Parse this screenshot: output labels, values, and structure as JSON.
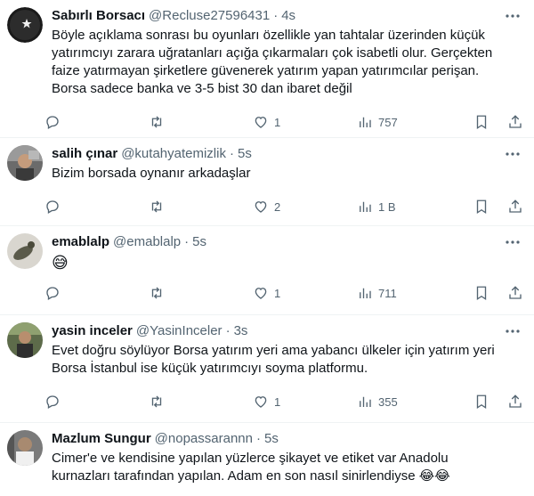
{
  "tweets": [
    {
      "name": "Sabırlı Borsacı",
      "handle": "@Recluse27596431",
      "dot": "·",
      "time": "4s",
      "text": "Böyle açıklama sonrası bu oyunları özellikle yan tahtalar üzerinden küçük\nyatırımcıyı zarara uğratanları açığa çıkarmaları çok isabetli olur. Gerçekten\nfaize yatırmayan şirketlere güvenerek yatırım yapan yatırımcılar perişan.\nBorsa sadece banka ve 3-5 bist 30 dan ibaret değil",
      "replies": "",
      "retweets": "",
      "likes": "1",
      "views": "757"
    },
    {
      "name": "salih çınar",
      "handle": "@kutahyatemizlik",
      "dot": "·",
      "time": "5s",
      "text": "Bizim borsada oynanır arkadaşlar",
      "replies": "",
      "retweets": "",
      "likes": "2",
      "views": "1 B"
    },
    {
      "name": "emablalp",
      "handle": "@emablalp",
      "dot": "·",
      "time": "5s",
      "text": "😅",
      "replies": "",
      "retweets": "",
      "likes": "1",
      "views": "711"
    },
    {
      "name": "yasin inceler",
      "handle": "@YasinInceler",
      "dot": "·",
      "time": "3s",
      "text": "Evet doğru söylüyor Borsa yatırım yeri ama yabancı ülkeler için yatırım yeri\nBorsa İstanbul ise küçük yatırımcıyı soyma platformu.",
      "replies": "",
      "retweets": "",
      "likes": "1",
      "views": "355"
    },
    {
      "name": "Mazlum Sungur",
      "handle": "@nopassarannn",
      "dot": "·",
      "time": "5s",
      "text": "Cimer'e ve kendisine yapılan yüzlerce şikayet ve etiket var Anadolu\nkurnazları tarafından yapılan. Adam en son nasıl sinirlendiyse 😂😂",
      "replies": "",
      "retweets": "",
      "likes": "",
      "views": ""
    }
  ],
  "icons": {
    "reply": "reply-icon",
    "retweet": "retweet-icon",
    "like": "heart-icon",
    "views": "views-icon",
    "bookmark": "bookmark-icon",
    "share": "share-icon",
    "more": "more-icon"
  },
  "colors": {
    "text": "#0f1419",
    "secondary": "#536471",
    "border": "#eff3f4"
  }
}
